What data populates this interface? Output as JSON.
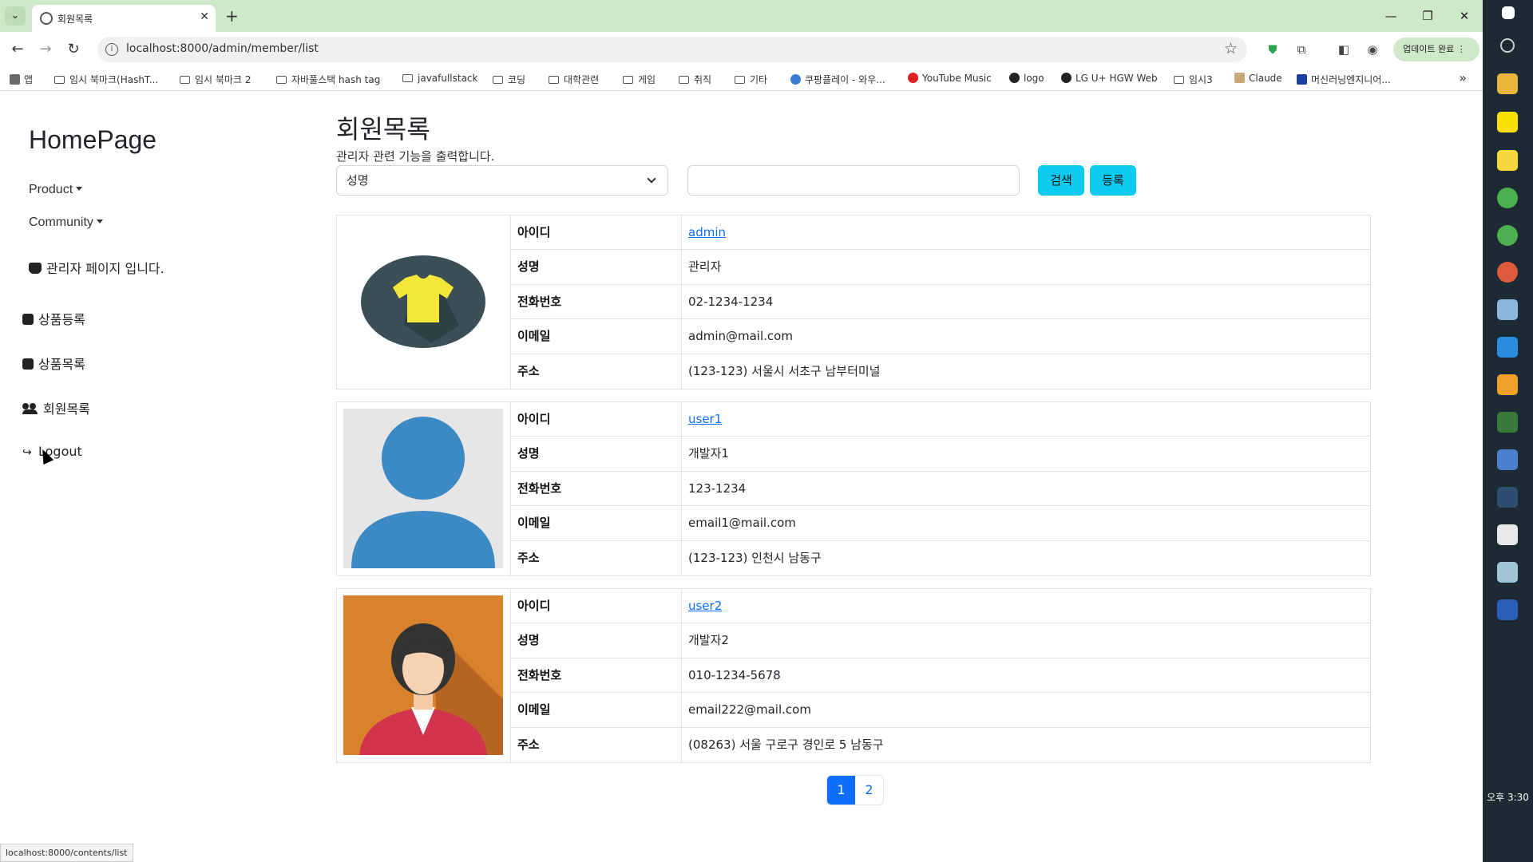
{
  "browser": {
    "tab_title": "회원목록",
    "url": "localhost:8000/admin/member/list",
    "update_label": "업데이트 완료",
    "bookmarks": [
      "앱",
      "임시 북마크(HashT...",
      "임시 북마크 2",
      "자바풀스택 hash tag",
      "javafullstack",
      "코딩",
      "대학관련",
      "게임",
      "취직",
      "기타",
      "쿠팡플레이 - 와우...",
      "YouTube Music",
      "logo",
      "LG U+ HGW Web",
      "임시3",
      "Claude",
      "머신러닝엔지니어..."
    ],
    "status_url": "localhost:8000/contents/list"
  },
  "sidebar": {
    "brand": "HomePage",
    "product": "Product",
    "community": "Community",
    "admin_note": "관리자 페이지 입니다.",
    "links": [
      "상품등록",
      "상품목록",
      "회원목록",
      "Logout"
    ]
  },
  "main": {
    "title": "회원목록",
    "description": "관리자 관련 기능을 출력합니다.",
    "search_field": "성명",
    "search_button": "검색",
    "register_button": "등록"
  },
  "labels": {
    "id": "아이디",
    "name": "성명",
    "phone": "전화번호",
    "email": "이메일",
    "address": "주소"
  },
  "members": [
    {
      "id": "admin",
      "name": "관리자",
      "phone": "02-1234-1234",
      "email": "admin@mail.com",
      "address": "(123-123) 서울시 서초구 남부터미널",
      "avatar": "t-shirt-icon"
    },
    {
      "id": "user1",
      "name": "개발자1",
      "phone": "123-1234",
      "email": "email1@mail.com",
      "address": "(123-123) 인천시 남동구",
      "avatar": "default-user-icon"
    },
    {
      "id": "user2",
      "name": "개발자2",
      "phone": "010-1234-5678",
      "email": "email222@mail.com",
      "address": "(08263) 서울 구로구 경인로 5 남동구",
      "avatar": "businesswoman-icon"
    }
  ],
  "pagination": {
    "pages": [
      "1",
      "2"
    ],
    "active": "1"
  },
  "taskbar": {
    "time": "오후 3:30"
  },
  "colors": {
    "accent": "#0dcaf0",
    "primary": "#0d6efd",
    "tab_bar": "#cfe8c9"
  }
}
